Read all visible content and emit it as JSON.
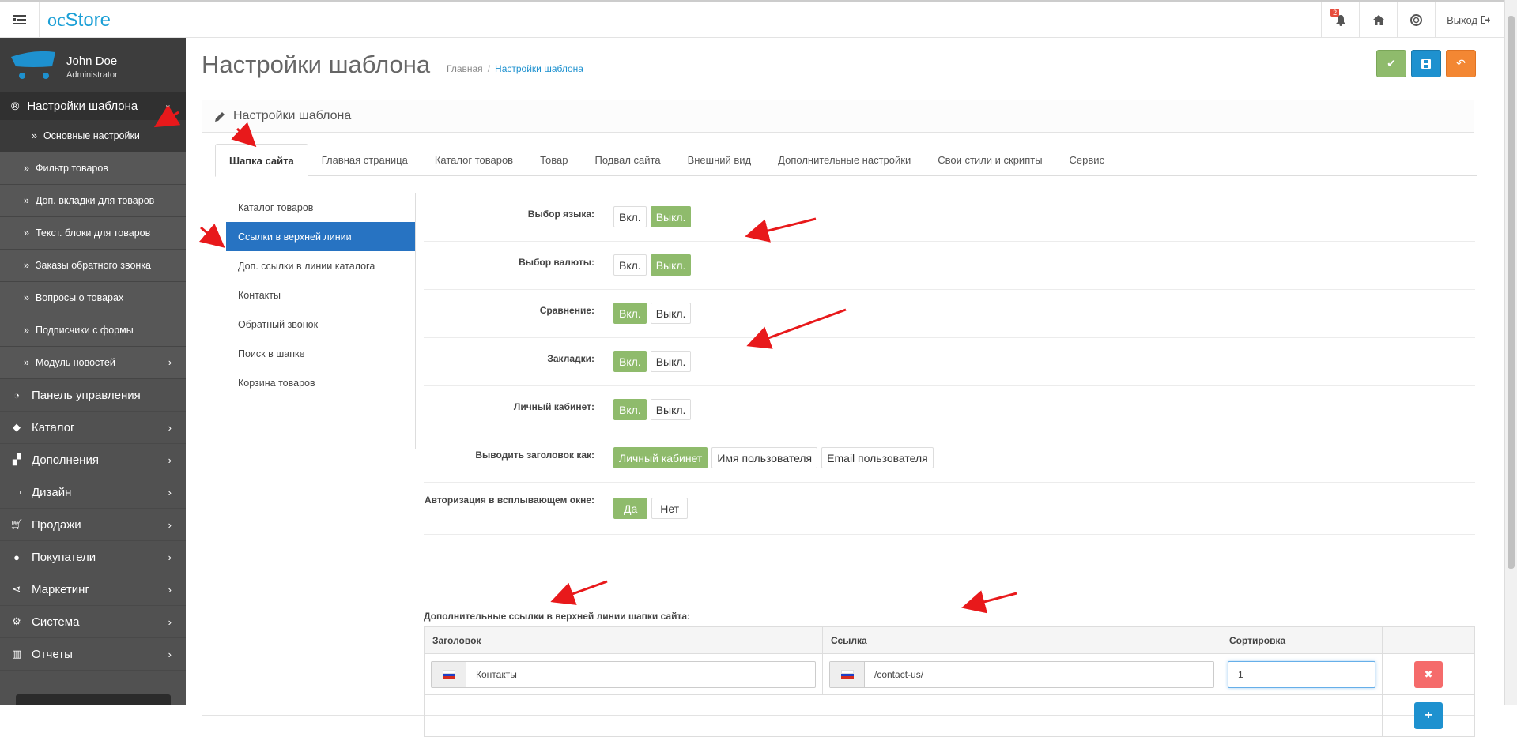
{
  "header": {
    "logo_oc": "oc",
    "logo_store": "Store",
    "notification_count": "2",
    "logout_label": "Выход"
  },
  "profile": {
    "name": "John Doe",
    "role": "Administrator"
  },
  "sidebar": {
    "active_section": "Настройки шаблона",
    "sub_items": [
      "Основные настройки",
      "Фильтр товаров",
      "Доп. вкладки для товаров",
      "Текст. блоки для товаров",
      "Заказы обратного звонка",
      "Вопросы о товарах",
      "Подписчики с формы",
      "Модуль новостей"
    ],
    "items": [
      "Панель управления",
      "Каталог",
      "Дополнения",
      "Дизайн",
      "Продажи",
      "Покупатели",
      "Маркетинг",
      "Система",
      "Отчеты"
    ]
  },
  "page": {
    "title": "Настройки шаблона",
    "breadcrumb_home": "Главная",
    "breadcrumb_current": "Настройки шаблона"
  },
  "panel": {
    "title": "Настройки шаблона"
  },
  "tabs": [
    "Шапка сайта",
    "Главная страница",
    "Каталог товаров",
    "Товар",
    "Подвал сайта",
    "Внешний вид",
    "Дополнительные настройки",
    "Свои стили и скрипты",
    "Сервис"
  ],
  "left_nav": [
    "Каталог товаров",
    "Ссылки в верхней линии",
    "Доп. ссылки в линии каталога",
    "Контакты",
    "Обратный звонок",
    "Поиск в шапке",
    "Корзина товаров"
  ],
  "settings": {
    "on": "Вкл.",
    "off": "Выкл.",
    "language": "Выбор языка:",
    "currency": "Выбор валюты:",
    "compare": "Сравнение:",
    "bookmarks": "Закладки:",
    "account": "Личный кабинет:",
    "heading_as": "Выводить заголовок как:",
    "heading_opt1": "Личный кабинет",
    "heading_opt2": "Имя пользователя",
    "heading_opt3": "Email пользователя",
    "popup_auth": "Авторизация в всплывающем окне:",
    "yes": "Да",
    "no": "Нет"
  },
  "extra_links": {
    "title": "Дополнительные ссылки в верхней линии шапки сайта:",
    "col_title": "Заголовок",
    "col_link": "Ссылка",
    "col_sort": "Сортировка",
    "row_title": "Контакты",
    "row_link": "/contact-us/",
    "row_sort": "1"
  },
  "colors": {
    "sidebar_bg": "#515151",
    "accent_green": "#8fbb6c",
    "accent_blue": "#1e91cf",
    "accent_orange": "#f38733",
    "active_nav": "#2773c2",
    "annotation_arrow": "#e8191b"
  }
}
